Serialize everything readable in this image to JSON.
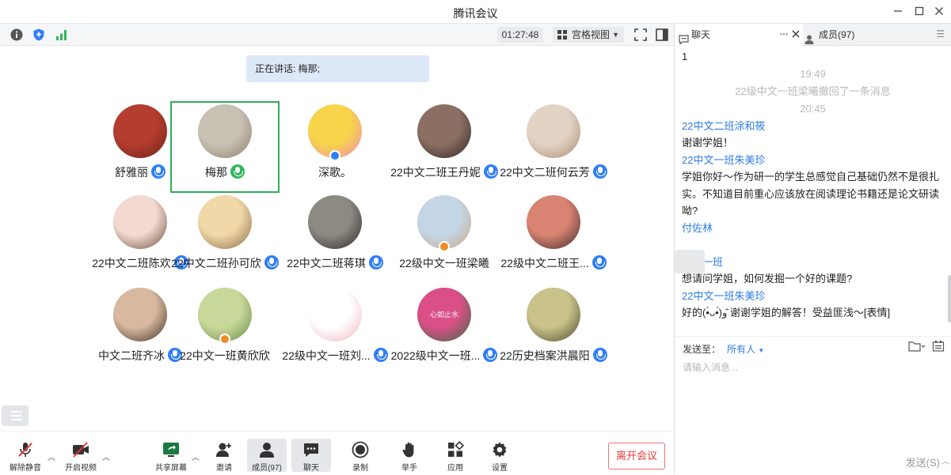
{
  "window": {
    "title": "腾讯会议"
  },
  "toolbar": {
    "timer": "01:27:48",
    "view_label": "宫格视图"
  },
  "stage": {
    "speaking": "正在讲话: 梅那;",
    "participants": [
      {
        "name": "舒雅丽",
        "active": false,
        "mic": "blue",
        "color": "#b43d2f",
        "color2": "#6e2218"
      },
      {
        "name": "梅那",
        "active": true,
        "mic": "green",
        "color": "#c9c2b4",
        "color2": "#8b7f6c"
      },
      {
        "name": "深歌。",
        "active": false,
        "mic": "none",
        "color": "#f7d44a",
        "color2": "#f08bb6"
      },
      {
        "name": "22中文二班王丹妮",
        "active": false,
        "mic": "blue",
        "color": "#8c6f63",
        "color2": "#2f2623"
      },
      {
        "name": "22中文二班何云芳",
        "active": false,
        "mic": "blue",
        "color": "#e3d3c5",
        "color2": "#a98c72"
      },
      {
        "name": "22中文二班陈欢",
        "active": false,
        "mic": "blue",
        "color": "#f3dad0",
        "color2": "#6b4b3d"
      },
      {
        "name": "22中文二班孙可欣",
        "active": false,
        "mic": "blue",
        "color": "#f0d8a8",
        "color2": "#8a6b47"
      },
      {
        "name": "22中文二班蒋琪",
        "active": false,
        "mic": "blue",
        "color": "#8d8a84",
        "color2": "#2b2624"
      },
      {
        "name": "22级中文一班梁曦",
        "active": false,
        "mic": "none",
        "color": "#c4d6e6",
        "color2": "#c8a882"
      },
      {
        "name": "22级中文二班王...",
        "active": false,
        "mic": "blue",
        "color": "#d98472",
        "color2": "#3b2a2c"
      },
      {
        "name": "中文二班齐冰",
        "active": false,
        "mic": "blue",
        "color": "#d8b99f",
        "color2": "#3f2e25"
      },
      {
        "name": "22中文一班黄欣欣",
        "active": false,
        "mic": "none",
        "color": "#c8d89a",
        "color2": "#6b8a4a"
      },
      {
        "name": "22级中文一班刘...",
        "active": false,
        "mic": "blue",
        "color": "#ffffff",
        "color2": "#f1b3c1"
      },
      {
        "name": "2022级中文一班...",
        "active": false,
        "mic": "blue",
        "color": "#d94f86",
        "color2": "#3a6e45",
        "overlay": "心如止水"
      },
      {
        "name": "22历史档案洪晨阳",
        "active": false,
        "mic": "blue",
        "color": "#c9c28a",
        "color2": "#4a4a2c"
      }
    ]
  },
  "bottombar": {
    "unmute": "解除静音",
    "video": "开启视频",
    "share": "共享屏幕",
    "invite": "邀请",
    "members": "成员(97)",
    "chat": "聊天",
    "record": "录制",
    "raise": "举手",
    "apps": "应用",
    "settings": "设置",
    "leave": "离开会议"
  },
  "panel": {
    "tab_chat": "聊天",
    "tab_members": "成员(97)",
    "messages": [
      {
        "type": "msg",
        "text": "1"
      },
      {
        "type": "sys",
        "text": "19:49"
      },
      {
        "type": "sys",
        "text": "22级中文一班梁曦撤回了一条消息"
      },
      {
        "type": "sys",
        "text": "20:45"
      },
      {
        "type": "sender",
        "text": "22中文二班涂和筱"
      },
      {
        "type": "msg",
        "text": "谢谢学姐！"
      },
      {
        "type": "sender",
        "text": "22中文一班朱美珍"
      },
      {
        "type": "msg",
        "text": "学姐你好～作为研一的学生总感觉自己基础仍然不是很扎"
      },
      {
        "type": "msg",
        "text": "实。不知道目前重心应该放在阅读理论书籍还是论文研读"
      },
      {
        "type": "msg",
        "text": "呦?"
      },
      {
        "type": "sender",
        "text": "付佐林"
      },
      {
        "type": "msg",
        "text": ""
      },
      {
        "type": "sender",
        "text": "中文一班"
      },
      {
        "type": "msg",
        "text": "想请问学姐，如何发掘一个好的课题?"
      },
      {
        "type": "sender",
        "text": "22中文一班朱美珍"
      },
      {
        "type": "msg",
        "text": "好的(•̀ᴗ•́)و ̑̑谢谢学姐的解答！受益匪浅～[表情]"
      }
    ],
    "send_to_label": "发送至：",
    "send_to_value": "所有人",
    "input_placeholder": "请输入消息...",
    "send_label": "发送(S)"
  }
}
